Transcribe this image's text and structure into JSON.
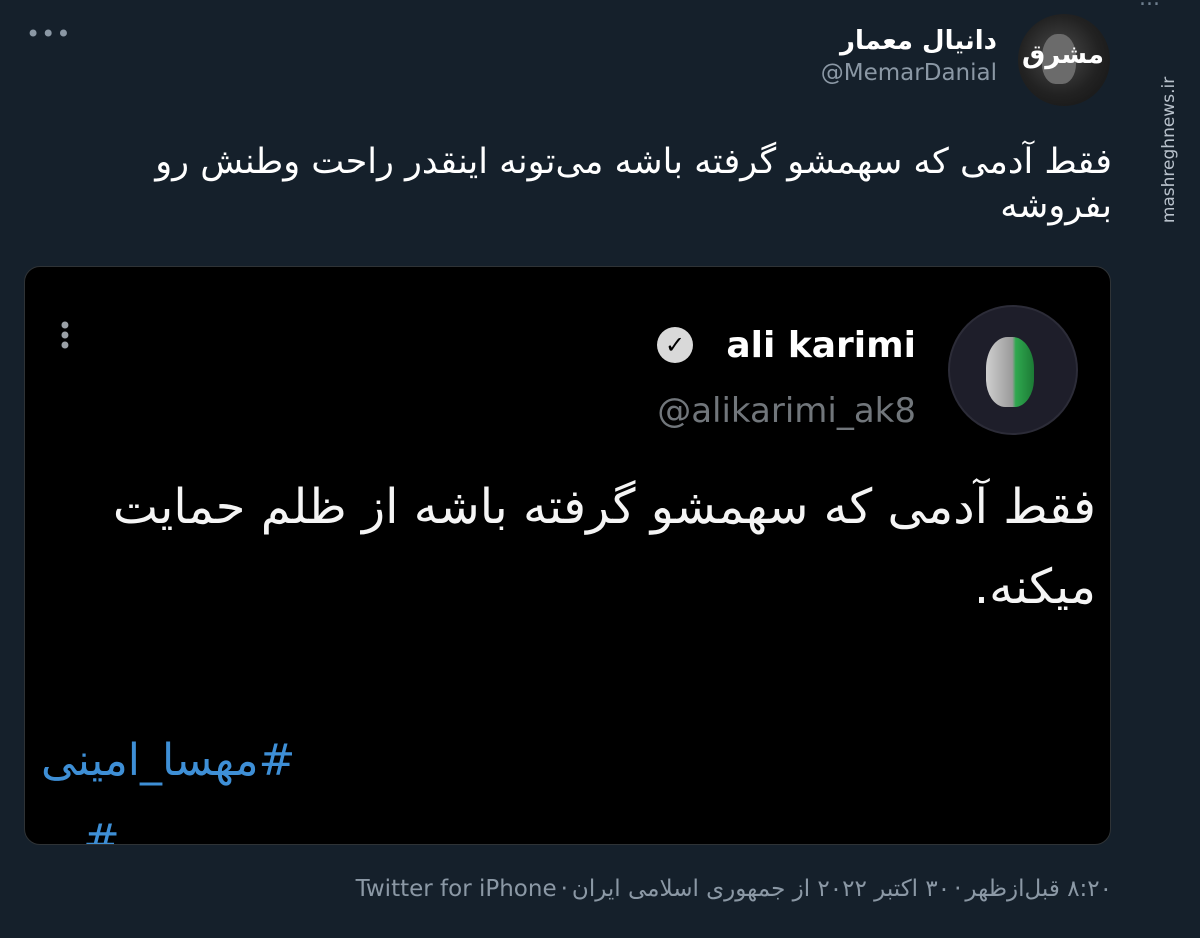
{
  "cut_text": "...",
  "watermark": "mashreghnews.ir",
  "author": {
    "name": "دانیال معمار",
    "handle": "@MemarDanial",
    "avatar_logo": "مشرق"
  },
  "more_label": "•••",
  "tweet_text": "فقط آدمی که سهمشو گرفته باشه می‌تونه اینقدر راحت وطنش رو بفروشه",
  "quoted": {
    "name": "ali karimi",
    "verified_mark": "✓",
    "handle": "@alikarimi_ak8",
    "text": "فقط آدمی که سهمشو گرفته باشه از ظلم حمایت میکنه.",
    "hashtag": "#مهسا_امینی",
    "hashtag_partial": "#...",
    "more_label": "⋮"
  },
  "meta": {
    "time": "۸:۲۰ قبل‌ازظهر",
    "date": "۳۰ اکتبر ۲۰۲۲ از جمهوری اسلامی ایران",
    "source": "Twitter for iPhone",
    "separator": "·"
  },
  "colors": {
    "background": "#15202b",
    "quote_background": "#000000",
    "link": "#3e8fd6",
    "secondary_text": "#8b98a5"
  }
}
